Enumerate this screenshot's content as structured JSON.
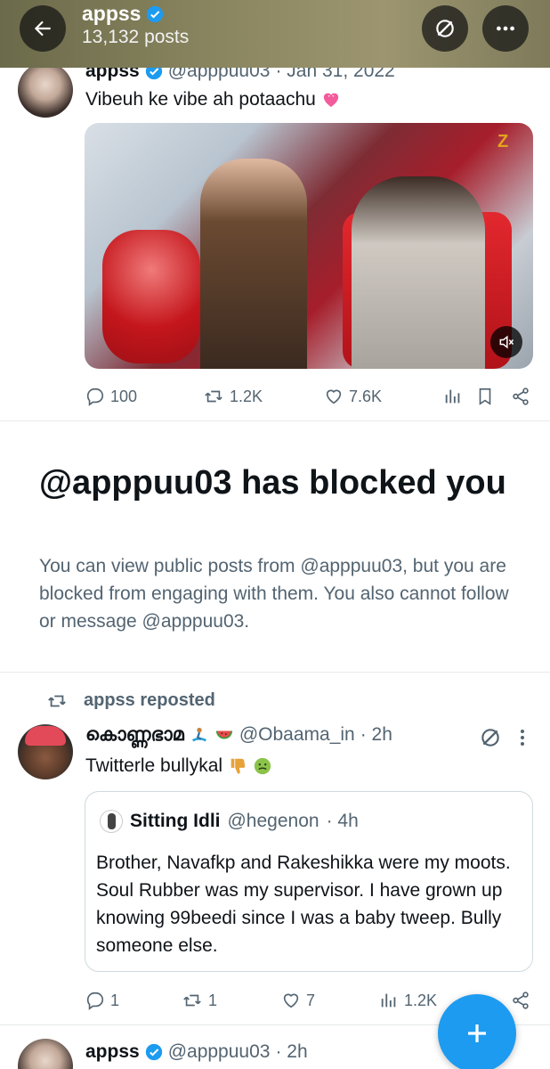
{
  "header": {
    "name": "appss",
    "posts_count": "13,132 posts"
  },
  "tweet1": {
    "name": "appss",
    "handle": "@apppuu03",
    "date": "· Jan 31, 2022",
    "text": "Vibeuh ke vibe ah potaachu",
    "replies": "100",
    "reposts": "1.2K",
    "likes": "7.6K"
  },
  "blocked": {
    "title": "@apppuu03 has blocked you",
    "description": "You can view public posts from @apppuu03, but you are blocked from engaging with them. You also cannot follow or message @apppuu03."
  },
  "repost": {
    "label": "appss reposted"
  },
  "tweet2": {
    "name": "കൊണ്ണഭാമ",
    "handle": "@Obaama_in",
    "time": "· 2h",
    "text": "Twitterle bullykal",
    "replies": "1",
    "reposts": "1",
    "likes": "7",
    "views": "1.2K",
    "quote": {
      "name": "Sitting Idli",
      "handle": "@hegenon",
      "time": "· 4h",
      "text": "Brother,  Navafkp and Rakeshikka were my moots. Soul Rubber was my supervisor. I have grown up knowing 99beedi since I was a baby tweep. Bully someone else."
    }
  },
  "tweet3": {
    "name": "appss",
    "handle": "@apppuu03",
    "time": "· 2h"
  },
  "colors": {
    "accent": "#1d9bf0",
    "secondary_text": "#536471",
    "primary_text": "#0f1419"
  }
}
